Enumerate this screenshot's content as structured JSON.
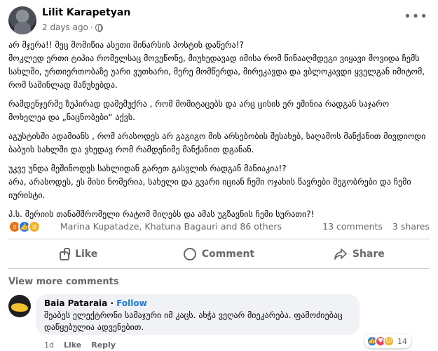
{
  "post": {
    "author": "Lilit Karapetyan",
    "time": "2 days ago",
    "dot": "·",
    "paragraphs": [
      "არ მჯერა!! მეც მომიწია ასეთი შინარსის პოსტის დაწერა!?\nმოკლედ ერთი ტიპია რომელსაც მოვეწონე, მიუხედავად იმისა რომ წინააღმდეგი ვიყავი მოვიდა ჩემს სახლში, ურთიერთობაზე უარი ვუთხარი, მერე მომწერდა, მირეკავდა და ვბლოკავდი ყველგან იმიტომ, რომ საშინლად მაწუხებდა.",
      "რამდენჯერმე ზუპირად დამემუქრა , რომ მომიტაცებს და არც ცისის ერ ეშინია რადგან საჯარო მოხელეა და „ნაცნობები“ აქვს.",
      "აგუსტისში ადამიანს , რომ არასოდეს არ გაგიგო მის არსებობის შესახებ, საღამოს მანქანით მივდიოდი ბაბუის სახლში და ვხედავ რომ რამდენიმე მანქანით დგანან.",
      "უკვე უნდა მეშინოდეს სახლიდან გარეთ გასვლის რადგან მანიაკია!?\nარა, არასოდეს, ეს მისი ნომერია, სახელი და გვარი იციან ჩემი ოჯახის წავრები მეგობრები და ჩემი იურისტი.",
      "პ.ს. მერიის თანამშრომელი რატომ მიღებს და ამას უგზავნის ჩემი სურათი?!"
    ],
    "reactions": {
      "names": "Marina Kupatadze, Khatuna Bagauri and 86 others",
      "comments": "13 comments",
      "shares": "3 shares"
    },
    "actions": {
      "like": "Like",
      "comment": "Comment",
      "share": "Share"
    },
    "view_more": "View more comments"
  },
  "comment": {
    "author": "Baia Pataraia",
    "dot": "·",
    "follow": "Follow",
    "text": "შეაბეს ელექტრონი სამაჯური იმ კაცს. ახჭა ვეღარ მიეკარება. ფამოძიებაც დაწყებულია ადვენებით.",
    "time": "1d",
    "like": "Like",
    "reply": "Reply",
    "reaction_count": "14"
  },
  "colors": {
    "accent": "#1877f2",
    "secondary_text": "#65676b"
  }
}
